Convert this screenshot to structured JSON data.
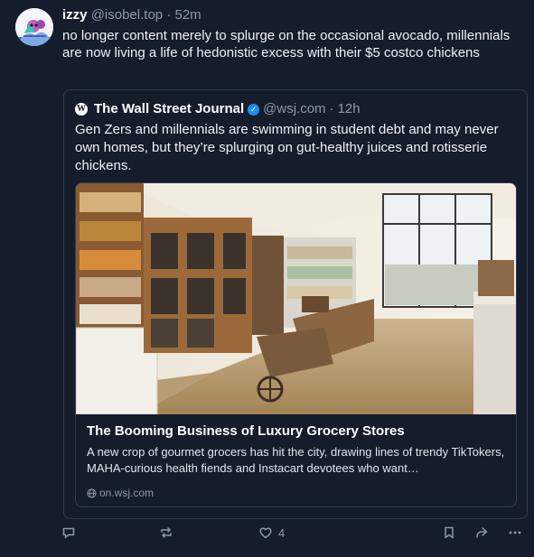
{
  "author": {
    "display_name": "izzy",
    "handle": "@isobel.top",
    "separator": "·",
    "time": "52m",
    "avatar_icon": "character-avatar-icon"
  },
  "post": {
    "text": "no longer content merely to splurge on the occasional avocado, millennials are now living a life of hedonistic excess with their $5 costco chickens"
  },
  "quote": {
    "avatar_letter": "W",
    "display_name": "The Wall Street Journal",
    "verified": "✓",
    "handle": "@wsj.com",
    "separator": "·",
    "time": "12h",
    "text": "Gen Zers and millennials are swimming in student debt and may never own homes, but they’re splurging on gut-healthy juices and rotisserie chickens.",
    "card": {
      "image_icon": "grocery-store-photo",
      "title": "The Booming Business of Luxury Grocery Stores",
      "description": "A new crop of gourmet grocers has hit the city, drawing lines of trendy TikTokers, MAHA-curious health fiends and Instacart devotees who want…",
      "link": "on.wsj.com"
    }
  },
  "actions": {
    "reply_icon": "reply-icon",
    "repost_icon": "repost-icon",
    "like_icon": "heart-icon",
    "like_count": "4",
    "bookmark_icon": "bookmark-icon",
    "share_icon": "share-icon",
    "more_icon": "more-icon"
  },
  "colors": {
    "background": "#151c2c",
    "border": "#323b4f",
    "muted": "#8f98ab",
    "verified": "#1d8cf2"
  }
}
